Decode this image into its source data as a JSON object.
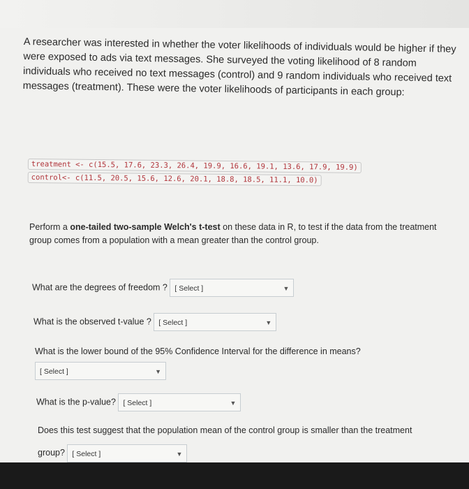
{
  "intro": "A researcher was interested in whether the voter likelihoods of individuals would be higher if they were exposed to ads via text messages. She surveyed the voting likelihood of 8 random individuals who received no text messages (control) and 9 random individuals who received text messages (treatment). These were the voter likelihoods of participants in each group:",
  "code": {
    "treatment": "treatment <- c(15.5, 17.6, 23.3, 26.4, 19.9, 16.6, 19.1, 13.6, 17.9, 19.9)",
    "control": "control<- c(11.5, 20.5, 15.6, 12.6, 20.1, 18.8, 18.5, 11.1, 10.0)"
  },
  "perform": {
    "before": "Perform a ",
    "bold": "one-tailed two-sample Welch's t-test",
    "after": " on these data in R, to test if the data from the treatment group comes from a population with a mean greater than the control group."
  },
  "questions": [
    {
      "label": "What are the degrees of freedom ?",
      "select": "[ Select ]"
    },
    {
      "label": "What is the observed t-value ?",
      "select": "[ Select ]"
    },
    {
      "label": "What is the lower bound of the 95% Confidence Interval for the difference in means?",
      "select": "[ Select ]"
    },
    {
      "label": "What is the p-value?",
      "select": "[ Select ]"
    },
    {
      "label": "Does this test suggest that the population mean of the control group is smaller than the treatment group?",
      "select": "[ Select ]"
    }
  ],
  "icons": {
    "dropdown": "chevron-down-icon"
  }
}
